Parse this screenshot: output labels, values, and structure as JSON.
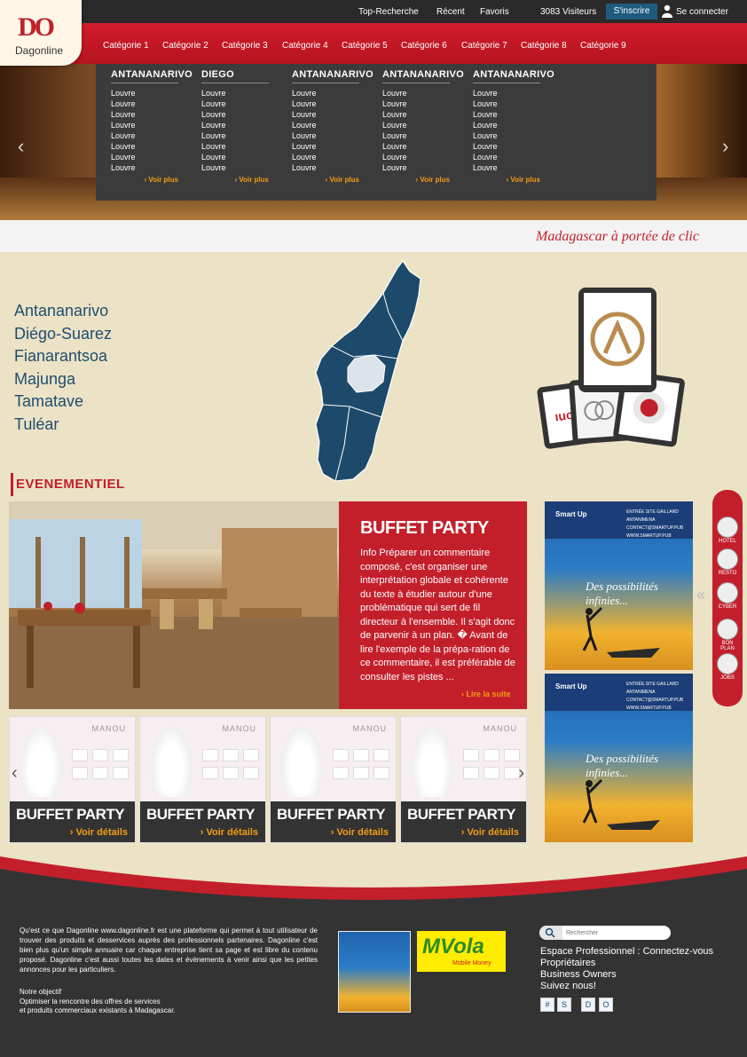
{
  "topbar": {
    "links": [
      "Top-Recherche",
      "Récent",
      "Favoris"
    ],
    "visitors": "3083 Visiteurs",
    "signup": "S'inscrire",
    "login": "Se connecter"
  },
  "logo": {
    "mark": "DO",
    "name": "Dagonline"
  },
  "categories": [
    "Catégorie 1",
    "Catégorie 2",
    "Catégorie 3",
    "Catégorie 4",
    "Catégorie 5",
    "Catégorie 6",
    "Catégorie 7",
    "Catégorie 8",
    "Catégorie 9"
  ],
  "megamenu": {
    "columns": [
      {
        "heading": "ANTANANARIVO",
        "items": [
          "Louvre",
          "Louvre",
          "Louvre",
          "Louvre",
          "Louvre",
          "Louvre",
          "Louvre",
          "Louvre"
        ],
        "more": "Voir plus"
      },
      {
        "heading": "DIEGO",
        "items": [
          "Louvre",
          "Louvre",
          "Louvre",
          "Louvre",
          "Louvre",
          "Louvre",
          "Louvre",
          "Louvre"
        ],
        "more": "Voir plus"
      },
      {
        "heading": "ANTANANARIVO",
        "items": [
          "Louvre",
          "Louvre",
          "Louvre",
          "Louvre",
          "Louvre",
          "Louvre",
          "Louvre",
          "Louvre"
        ],
        "more": "Voir plus"
      },
      {
        "heading": "ANTANANARIVO",
        "items": [
          "Louvre",
          "Louvre",
          "Louvre",
          "Louvre",
          "Louvre",
          "Louvre",
          "Louvre",
          "Louvre"
        ],
        "more": "Voir plus"
      },
      {
        "heading": "ANTANANARIVO",
        "items": [
          "Louvre",
          "Louvre",
          "Louvre",
          "Louvre",
          "Louvre",
          "Louvre",
          "Louvre",
          "Louvre"
        ],
        "more": "Voir plus"
      }
    ],
    "icon": "plate-cutlery-icon"
  },
  "tagline": "Madagascar à portée de clic",
  "cities": [
    "Antananarivo",
    "Diégo-Suarez",
    "Fianarantsoa",
    "Majunga",
    "Tamatave",
    "Tuléar"
  ],
  "events": {
    "section_title": "EVENEMENTIEL",
    "featured": {
      "title": "BUFFET PARTY",
      "text": "Info Préparer un commentaire composé, c'est organiser une interprétation globale et cohérente du texte à étudier autour d'une problématique qui sert de fil directeur à l'ensemble. Il s'agit donc de parvenir à un plan. � Avant de lire l'exemple de la prépa-ration de ce commentaire, il est préférable de consulter les pistes ...",
      "more": "Lire la suite"
    },
    "cards": [
      {
        "brand": "MANOU",
        "title": "BUFFET PARTY",
        "link": "Voir détails"
      },
      {
        "brand": "MANOU",
        "title": "BUFFET PARTY",
        "link": "Voir détails"
      },
      {
        "brand": "MANOU",
        "title": "BUFFET PARTY",
        "link": "Voir détails"
      },
      {
        "brand": "MANOU",
        "title": "BUFFET PARTY",
        "link": "Voir détails"
      }
    ]
  },
  "ads": [
    {
      "brand": "Smart Up",
      "info": [
        "ENTRÉE SITE GAILLARD ANTANIMENA",
        "CONTACT@SMARTUP.PUB",
        "WWW.SMARTUP.PUB"
      ],
      "slogan": "Des possibilités infinies..."
    },
    {
      "brand": "Smart Up",
      "info": [
        "ENTRÉE SITE GAILLARD ANTANIMENA",
        "CONTACT@SMARTUP.PUB",
        "WWW.SMARTUP.PUB"
      ],
      "slogan": "Des possibilités infinies..."
    }
  ],
  "sidebar": [
    {
      "label": "HOTEL",
      "icon": "house-icon"
    },
    {
      "label": "RESTO",
      "icon": "plate-icon"
    },
    {
      "label": "CYBER",
      "icon": "laptop-icon"
    },
    {
      "label": "BON PLAN",
      "icon": "cocktail-icon"
    },
    {
      "label": "JOBS",
      "icon": "briefcase-icon"
    }
  ],
  "footer": {
    "about": "Qu'est ce que Dagonline www.dagonline.fr est une plateforme qui permet à tout utilisateur de trouver des produits et desservices auprès des professionnels partenaires. Dagonline c'est bien plus qu'un simple annuaire car chaque entreprise tient sa page et est libre du contenu proposé. Dagonline c'est aussi toutes les dates et évènements à venir ainsi que les petites annonces pour les particuliers.",
    "objective_title": "Notre objectif",
    "objective_lines": [
      "Optimiser la rencontre des offres de services",
      "et produits commerciaux existants à Madagascar."
    ],
    "mvola": {
      "brand": "MVola",
      "sub": "Mobile Money"
    },
    "search_placeholder": "Rechercher",
    "links": [
      "Espace Professionnel : Connectez-vous",
      "Propriétaires",
      "Business Owners",
      "Suivez nous!"
    ],
    "social": [
      "#",
      "S",
      "D",
      "O"
    ]
  },
  "colors": {
    "red": "#c31f2b",
    "dark": "#333333",
    "navy": "#1f4e6e",
    "orange": "#f39c12"
  }
}
